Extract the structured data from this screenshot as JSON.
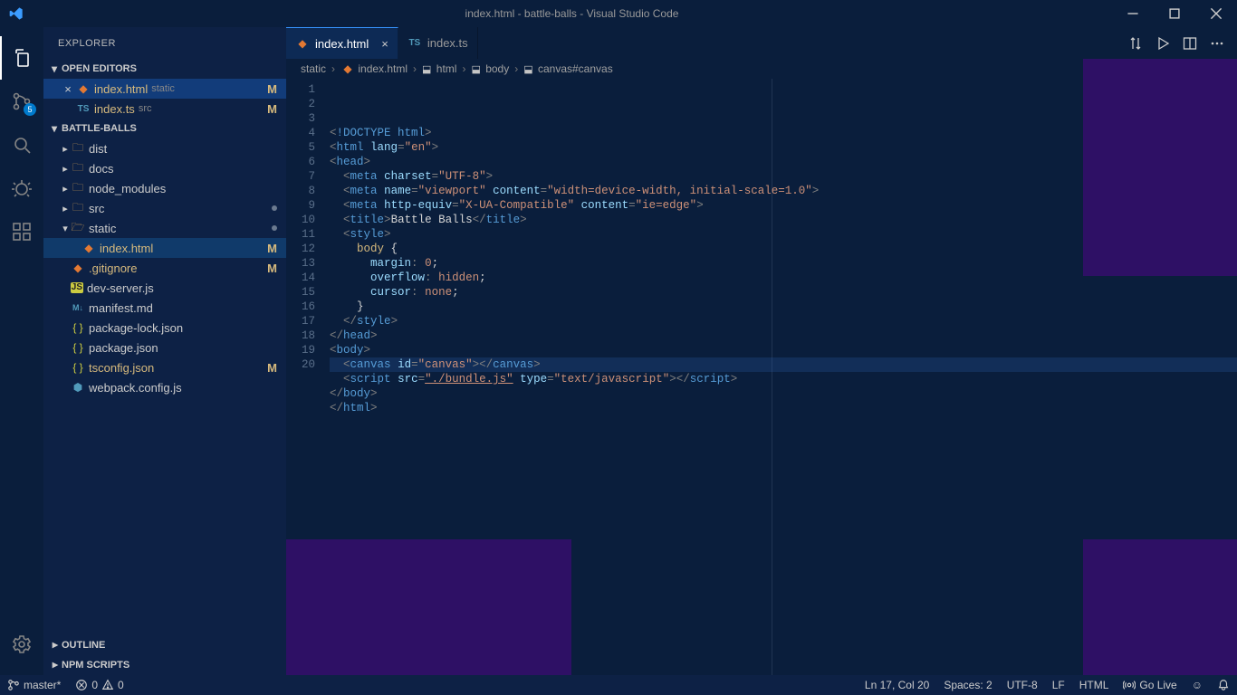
{
  "window": {
    "title": "index.html - battle-balls - Visual Studio Code"
  },
  "explorer": {
    "header": "EXPLORER",
    "sections": {
      "open_editors": {
        "label": "OPEN EDITORS",
        "items": [
          {
            "name": "index.html",
            "detail": "static",
            "git": "M",
            "active": true,
            "icon": "html"
          },
          {
            "name": "index.ts",
            "detail": "src",
            "git": "M",
            "active": false,
            "icon": "ts"
          }
        ]
      },
      "folder": {
        "label": "BATTLE-BALLS",
        "items": [
          {
            "name": "dist",
            "icon": "folder"
          },
          {
            "name": "docs",
            "icon": "folder"
          },
          {
            "name": "node_modules",
            "icon": "folder"
          },
          {
            "name": "src",
            "icon": "folder",
            "dot": true
          },
          {
            "name": "static",
            "icon": "folder-open",
            "dot": true
          },
          {
            "name": "index.html",
            "icon": "html",
            "git": "M",
            "indent": true,
            "selected": true
          },
          {
            "name": ".gitignore",
            "icon": "git",
            "git": "M"
          },
          {
            "name": "dev-server.js",
            "icon": "js"
          },
          {
            "name": "manifest.md",
            "icon": "md"
          },
          {
            "name": "package-lock.json",
            "icon": "json"
          },
          {
            "name": "package.json",
            "icon": "json"
          },
          {
            "name": "tsconfig.json",
            "icon": "json-y",
            "git": "M"
          },
          {
            "name": "webpack.config.js",
            "icon": "wp"
          }
        ]
      },
      "outline": {
        "label": "OUTLINE"
      },
      "npm_scripts": {
        "label": "NPM SCRIPTS"
      }
    }
  },
  "tabs": [
    {
      "name": "index.html",
      "icon": "html",
      "active": true
    },
    {
      "name": "index.ts",
      "icon": "ts",
      "active": false
    }
  ],
  "breadcrumbs": [
    {
      "text": "static"
    },
    {
      "text": "index.html",
      "icon": "html"
    },
    {
      "text": "html",
      "icon": "sym"
    },
    {
      "text": "body",
      "icon": "sym"
    },
    {
      "text": "canvas#canvas",
      "icon": "sym"
    }
  ],
  "code": {
    "lines": [
      "<!DOCTYPE html>",
      "<html lang=\"en\">",
      "<head>",
      "  <meta charset=\"UTF-8\">",
      "  <meta name=\"viewport\" content=\"width=device-width, initial-scale=1.0\">",
      "  <meta http-equiv=\"X-UA-Compatible\" content=\"ie=edge\">",
      "  <title>Battle Balls</title>",
      "  <style>",
      "    body {",
      "      margin: 0;",
      "      overflow: hidden;",
      "      cursor: none;",
      "    }",
      "  </style>",
      "</head>",
      "<body>",
      "  <canvas id=\"canvas\"></canvas>",
      "  <script src=\"./bundle.js\" type=\"text/javascript\"></script>",
      "</body>",
      "</html>"
    ],
    "active_line": 17
  },
  "statusbar": {
    "branch": "master*",
    "errors": "0",
    "warnings": "0",
    "cursor": "Ln 17, Col 20",
    "spaces": "Spaces: 2",
    "encoding": "UTF-8",
    "eol": "LF",
    "language": "HTML",
    "golive": "Go Live",
    "feedback": "☺"
  },
  "scm_badge": "5"
}
